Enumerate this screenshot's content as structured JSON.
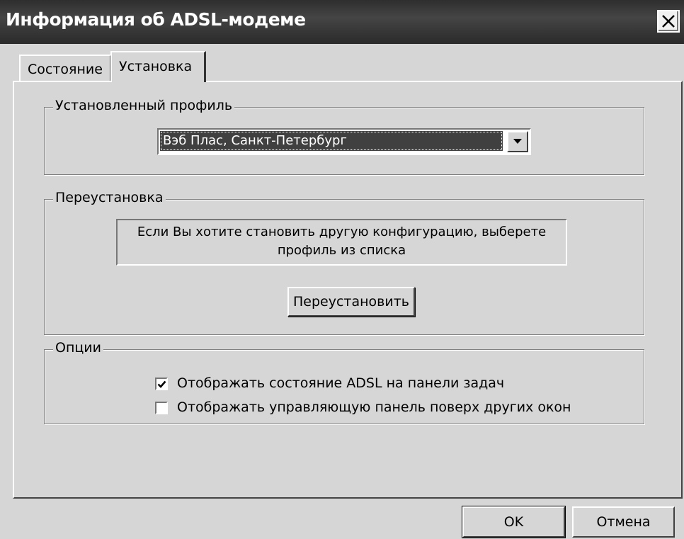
{
  "window": {
    "title": "Информация об ADSL-модеме"
  },
  "tabs": [
    {
      "label": "Состояние",
      "active": false
    },
    {
      "label": "Установка",
      "active": true
    }
  ],
  "installed_profile": {
    "group_title": "Установленный профиль",
    "selected": "Вэб Плас, Санкт-Петербург"
  },
  "reinstall": {
    "group_title": "Переустановка",
    "info_line1": "Если Вы хотите становить другую конфигурацию, выберете",
    "info_line2": "профиль из списка",
    "button_label": "Переустановить"
  },
  "options": {
    "group_title": "Опции",
    "items": [
      {
        "label": "Отображать состояние ADSL на панели задач",
        "checked": true
      },
      {
        "label": "Отображать управляющую панель поверх других окон",
        "checked": false
      }
    ]
  },
  "footer": {
    "ok_label": "OK",
    "cancel_label": "Отмена"
  }
}
